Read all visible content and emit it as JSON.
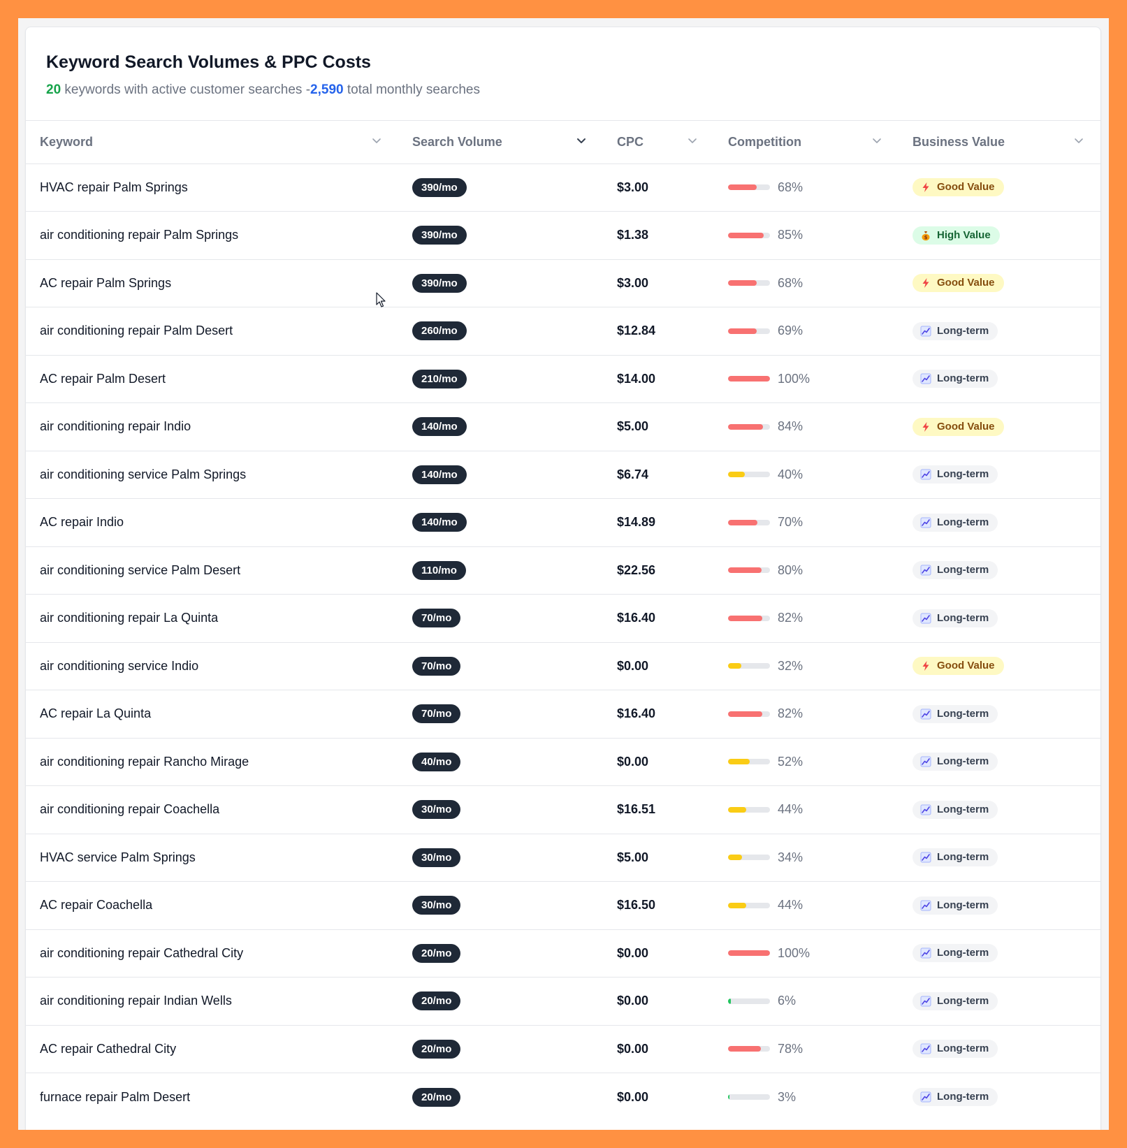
{
  "header": {
    "title": "Keyword Search Volumes & PPC Costs",
    "keyword_count": "20",
    "subtitle_mid": " keywords with active customer searches -",
    "total_searches": "2,590",
    "subtitle_end": " total monthly searches"
  },
  "columns": {
    "keyword": "Keyword",
    "search_volume": "Search Volume",
    "cpc": "CPC",
    "competition": "Competition",
    "business_value": "Business Value"
  },
  "colors": {
    "comp_high": "#f87171",
    "comp_mid": "#facc15",
    "comp_low": "#22c55e",
    "accent_green": "#16a34a",
    "accent_blue": "#2563eb"
  },
  "rows": [
    {
      "keyword": "HVAC repair Palm Springs",
      "volume": "390/mo",
      "cpc": "$3.00",
      "competition": 68,
      "competition_label": "68%",
      "value": "Good Value",
      "value_type": "good",
      "value_icon": "lightning-icon"
    },
    {
      "keyword": "air conditioning repair Palm Springs",
      "volume": "390/mo",
      "cpc": "$1.38",
      "competition": 85,
      "competition_label": "85%",
      "value": "High Value",
      "value_type": "high",
      "value_icon": "money-bag-icon"
    },
    {
      "keyword": "AC repair Palm Springs",
      "volume": "390/mo",
      "cpc": "$3.00",
      "competition": 68,
      "competition_label": "68%",
      "value": "Good Value",
      "value_type": "good",
      "value_icon": "lightning-icon"
    },
    {
      "keyword": "air conditioning repair Palm Desert",
      "volume": "260/mo",
      "cpc": "$12.84",
      "competition": 69,
      "competition_label": "69%",
      "value": "Long-term",
      "value_type": "long",
      "value_icon": "chart-up-icon"
    },
    {
      "keyword": "AC repair Palm Desert",
      "volume": "210/mo",
      "cpc": "$14.00",
      "competition": 100,
      "competition_label": "100%",
      "value": "Long-term",
      "value_type": "long",
      "value_icon": "chart-up-icon"
    },
    {
      "keyword": "air conditioning repair Indio",
      "volume": "140/mo",
      "cpc": "$5.00",
      "competition": 84,
      "competition_label": "84%",
      "value": "Good Value",
      "value_type": "good",
      "value_icon": "lightning-icon"
    },
    {
      "keyword": "air conditioning service Palm Springs",
      "volume": "140/mo",
      "cpc": "$6.74",
      "competition": 40,
      "competition_label": "40%",
      "value": "Long-term",
      "value_type": "long",
      "value_icon": "chart-up-icon"
    },
    {
      "keyword": "AC repair Indio",
      "volume": "140/mo",
      "cpc": "$14.89",
      "competition": 70,
      "competition_label": "70%",
      "value": "Long-term",
      "value_type": "long",
      "value_icon": "chart-up-icon"
    },
    {
      "keyword": "air conditioning service Palm Desert",
      "volume": "110/mo",
      "cpc": "$22.56",
      "competition": 80,
      "competition_label": "80%",
      "value": "Long-term",
      "value_type": "long",
      "value_icon": "chart-up-icon"
    },
    {
      "keyword": "air conditioning repair La Quinta",
      "volume": "70/mo",
      "cpc": "$16.40",
      "competition": 82,
      "competition_label": "82%",
      "value": "Long-term",
      "value_type": "long",
      "value_icon": "chart-up-icon"
    },
    {
      "keyword": "air conditioning service Indio",
      "volume": "70/mo",
      "cpc": "$0.00",
      "competition": 32,
      "competition_label": "32%",
      "value": "Good Value",
      "value_type": "good",
      "value_icon": "lightning-icon"
    },
    {
      "keyword": "AC repair La Quinta",
      "volume": "70/mo",
      "cpc": "$16.40",
      "competition": 82,
      "competition_label": "82%",
      "value": "Long-term",
      "value_type": "long",
      "value_icon": "chart-up-icon"
    },
    {
      "keyword": "air conditioning repair Rancho Mirage",
      "volume": "40/mo",
      "cpc": "$0.00",
      "competition": 52,
      "competition_label": "52%",
      "value": "Long-term",
      "value_type": "long",
      "value_icon": "chart-up-icon"
    },
    {
      "keyword": "air conditioning repair Coachella",
      "volume": "30/mo",
      "cpc": "$16.51",
      "competition": 44,
      "competition_label": "44%",
      "value": "Long-term",
      "value_type": "long",
      "value_icon": "chart-up-icon"
    },
    {
      "keyword": "HVAC service Palm Springs",
      "volume": "30/mo",
      "cpc": "$5.00",
      "competition": 34,
      "competition_label": "34%",
      "value": "Long-term",
      "value_type": "long",
      "value_icon": "chart-up-icon"
    },
    {
      "keyword": "AC repair Coachella",
      "volume": "30/mo",
      "cpc": "$16.50",
      "competition": 44,
      "competition_label": "44%",
      "value": "Long-term",
      "value_type": "long",
      "value_icon": "chart-up-icon"
    },
    {
      "keyword": "air conditioning repair Cathedral City",
      "volume": "20/mo",
      "cpc": "$0.00",
      "competition": 100,
      "competition_label": "100%",
      "value": "Long-term",
      "value_type": "long",
      "value_icon": "chart-up-icon"
    },
    {
      "keyword": "air conditioning repair Indian Wells",
      "volume": "20/mo",
      "cpc": "$0.00",
      "competition": 6,
      "competition_label": "6%",
      "value": "Long-term",
      "value_type": "long",
      "value_icon": "chart-up-icon"
    },
    {
      "keyword": "AC repair Cathedral City",
      "volume": "20/mo",
      "cpc": "$0.00",
      "competition": 78,
      "competition_label": "78%",
      "value": "Long-term",
      "value_type": "long",
      "value_icon": "chart-up-icon"
    },
    {
      "keyword": "furnace repair Palm Desert",
      "volume": "20/mo",
      "cpc": "$0.00",
      "competition": 3,
      "competition_label": "3%",
      "value": "Long-term",
      "value_type": "long",
      "value_icon": "chart-up-icon"
    }
  ]
}
